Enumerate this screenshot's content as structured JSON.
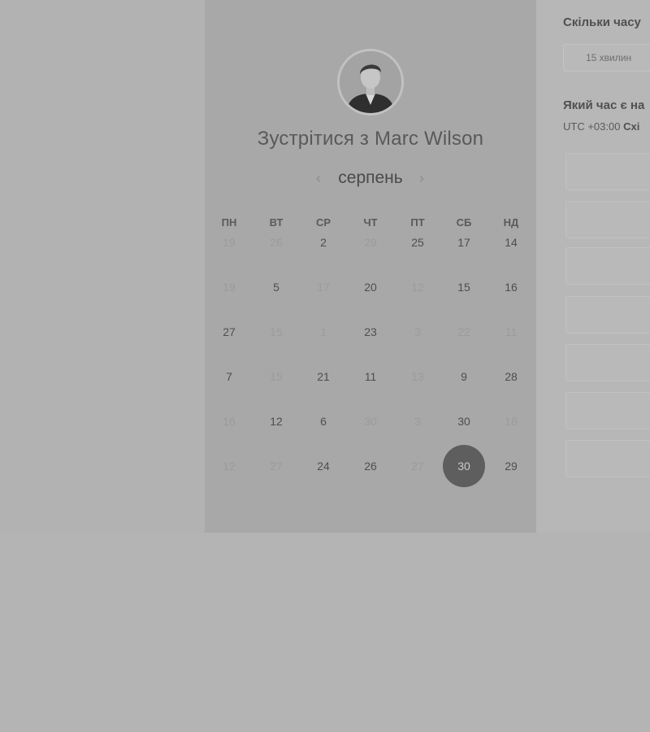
{
  "organizer": {
    "title": "Зустрітися з Marc Wilson"
  },
  "calendar": {
    "month": "серпень",
    "prev_arrow": "‹",
    "next_arrow": "›",
    "weekdays": [
      "ПН",
      "ВТ",
      "СР",
      "ЧТ",
      "ПТ",
      "СБ",
      "НД"
    ],
    "weeks": [
      [
        {
          "d": "19",
          "a": false
        },
        {
          "d": "26",
          "a": false
        },
        {
          "d": "2",
          "a": true
        },
        {
          "d": "29",
          "a": false
        },
        {
          "d": "25",
          "a": true
        },
        {
          "d": "17",
          "a": true
        },
        {
          "d": "14",
          "a": true
        }
      ],
      [
        {
          "d": "19",
          "a": false
        },
        {
          "d": "5",
          "a": true
        },
        {
          "d": "17",
          "a": false
        },
        {
          "d": "20",
          "a": true
        },
        {
          "d": "12",
          "a": false
        },
        {
          "d": "15",
          "a": true
        },
        {
          "d": "16",
          "a": true
        }
      ],
      [
        {
          "d": "27",
          "a": true
        },
        {
          "d": "15",
          "a": false
        },
        {
          "d": "1",
          "a": false
        },
        {
          "d": "23",
          "a": true
        },
        {
          "d": "3",
          "a": false
        },
        {
          "d": "22",
          "a": false
        },
        {
          "d": "11",
          "a": false
        }
      ],
      [
        {
          "d": "7",
          "a": true
        },
        {
          "d": "15",
          "a": false
        },
        {
          "d": "21",
          "a": true
        },
        {
          "d": "11",
          "a": true
        },
        {
          "d": "13",
          "a": false
        },
        {
          "d": "9",
          "a": true
        },
        {
          "d": "28",
          "a": true
        }
      ],
      [
        {
          "d": "16",
          "a": false
        },
        {
          "d": "12",
          "a": true
        },
        {
          "d": "6",
          "a": true
        },
        {
          "d": "30",
          "a": false
        },
        {
          "d": "3",
          "a": false
        },
        {
          "d": "30",
          "a": true
        },
        {
          "d": "18",
          "a": false
        }
      ],
      [
        {
          "d": "12",
          "a": false
        },
        {
          "d": "27",
          "a": false
        },
        {
          "d": "24",
          "a": true
        },
        {
          "d": "26",
          "a": true
        },
        {
          "d": "27",
          "a": false
        },
        {
          "d": "30",
          "a": true,
          "selected": true
        },
        {
          "d": "29",
          "a": true
        }
      ]
    ]
  },
  "booking": {
    "duration_heading": "Скільки часу",
    "duration_value": "15 хвилин",
    "time_heading": "Який час є на",
    "timezone_prefix": "UTC +03:00",
    "timezone_name": "Схі"
  }
}
